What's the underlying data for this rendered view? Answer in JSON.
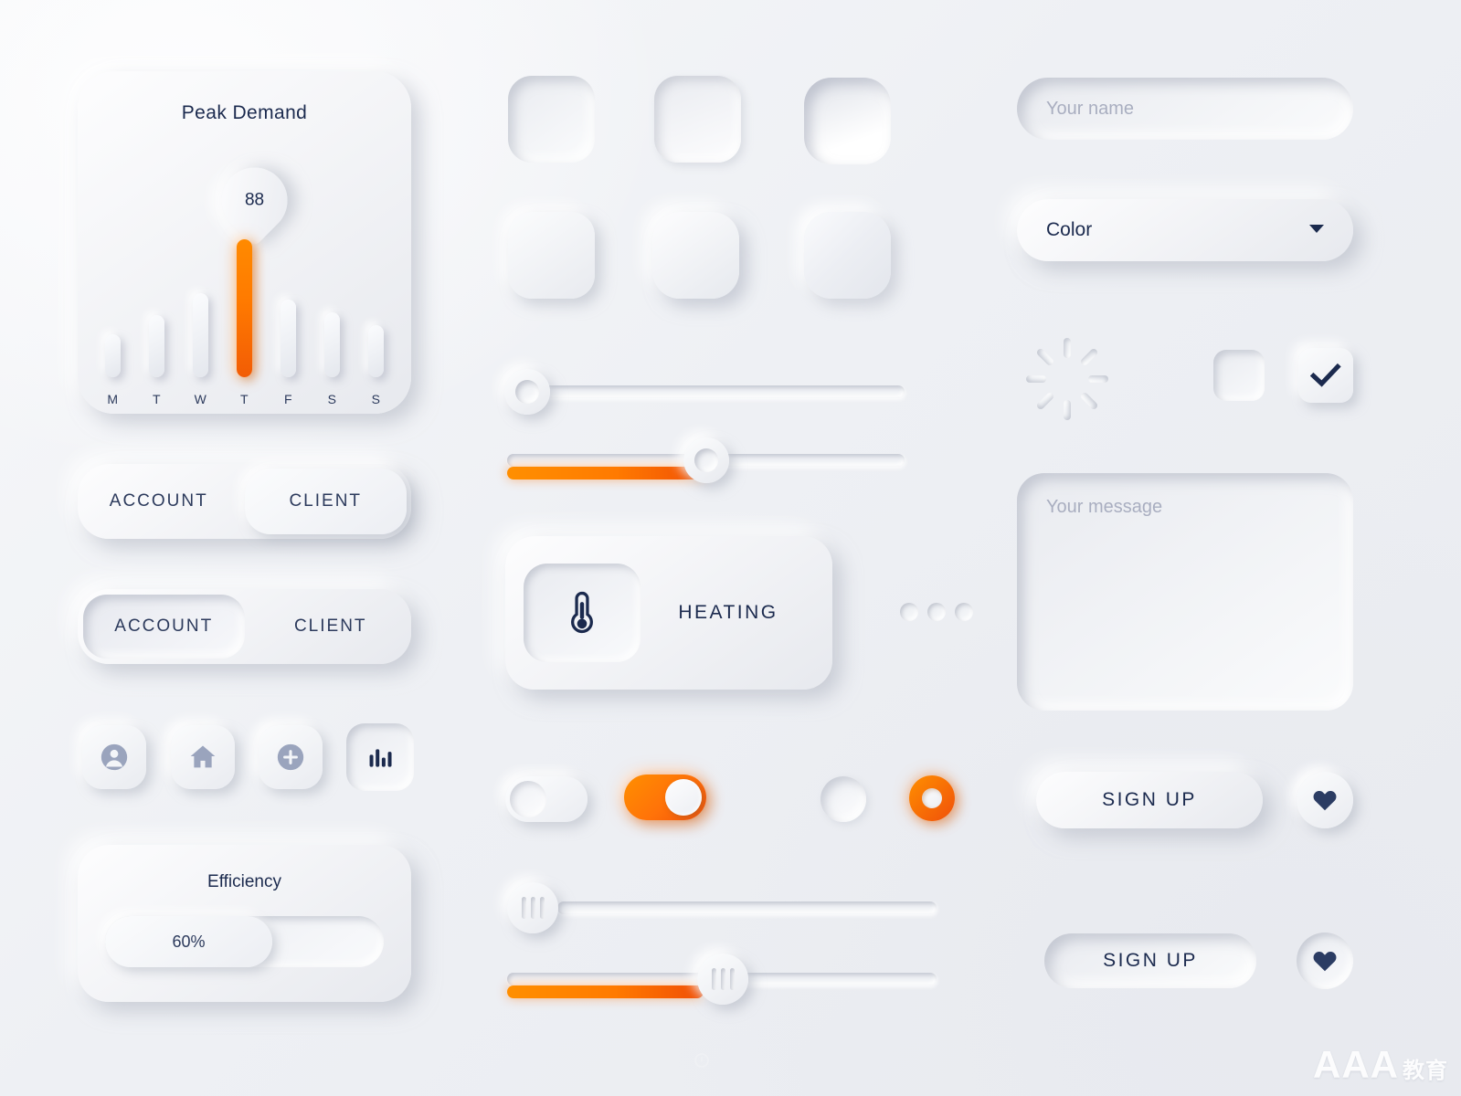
{
  "peak_card": {
    "title": "Peak Demand",
    "value": "88",
    "chart_data": {
      "type": "bar",
      "title": "Peak Demand",
      "categories": [
        "M",
        "T",
        "W",
        "T",
        "F",
        "S",
        "S"
      ],
      "values": [
        40,
        58,
        78,
        128,
        72,
        60,
        48
      ],
      "highlight_index": 3,
      "highlight_label": "88",
      "xlabel": "",
      "ylabel": "",
      "ylim": [
        0,
        140
      ],
      "grid": false,
      "legend": "none",
      "accent_color": "#ff7a00"
    }
  },
  "segmented_top": {
    "left_label": "ACCOUNT",
    "right_label": "CLIENT",
    "active": "CLIENT"
  },
  "segmented_bottom": {
    "left_label": "ACCOUNT",
    "right_label": "CLIENT",
    "active": "ACCOUNT"
  },
  "icon_buttons": [
    {
      "icon": "user-icon",
      "state": "raised"
    },
    {
      "icon": "home-icon",
      "state": "raised"
    },
    {
      "icon": "plus-circle-icon",
      "state": "raised"
    },
    {
      "icon": "bar-chart-icon",
      "state": "inset"
    }
  ],
  "efficiency": {
    "title": "Efficiency",
    "value_label": "60%",
    "percent": 60
  },
  "squares": [
    {
      "name": "square-inset-1",
      "style": "a"
    },
    {
      "name": "square-inset-2",
      "style": "b"
    },
    {
      "name": "square-inset-deep",
      "style": "c"
    },
    {
      "name": "square-raised-1",
      "style": "d"
    },
    {
      "name": "square-raised-2",
      "style": "e"
    },
    {
      "name": "square-raised-bevel",
      "style": "f"
    }
  ],
  "sliders": [
    {
      "name": "slider-circle-empty",
      "percent": 0,
      "handle": "circle",
      "filled": false
    },
    {
      "name": "slider-circle-filled",
      "percent": 45,
      "handle": "circle",
      "filled": true
    },
    {
      "name": "slider-ribbed-empty",
      "percent": 0,
      "handle": "ribbed",
      "filled": false
    },
    {
      "name": "slider-ribbed-filled",
      "percent": 45,
      "handle": "ribbed",
      "filled": true
    }
  ],
  "heating": {
    "label": "HEATING",
    "icon": "thermometer-icon"
  },
  "toggles": [
    {
      "name": "toggle-off",
      "state": "off"
    },
    {
      "name": "toggle-on",
      "state": "on"
    }
  ],
  "radios": [
    {
      "name": "radio-unselected",
      "state": "off"
    },
    {
      "name": "radio-selected",
      "state": "on"
    }
  ],
  "form": {
    "name_placeholder": "Your name",
    "select_label": "Color",
    "message_placeholder": "Your message"
  },
  "checkboxes": [
    {
      "name": "checkbox-unchecked",
      "checked": false
    },
    {
      "name": "checkbox-checked",
      "checked": true
    }
  ],
  "signup_buttons": [
    {
      "label": "SIGN UP",
      "state": "raised"
    },
    {
      "label": "SIGN UP",
      "state": "inset"
    }
  ],
  "heart_buttons": [
    {
      "icon": "heart-icon",
      "state": "raised"
    },
    {
      "icon": "heart-icon",
      "state": "inset"
    }
  ],
  "colors": {
    "accent_orange": "#ff7a00",
    "accent_orange_dark": "#f04e05",
    "navy_text": "#1b2a4e",
    "muted_text": "#a9aec0",
    "surface_light": "#fdfdfe",
    "surface_dark": "#e7e9ee"
  },
  "watermark": {
    "main": "AAA",
    "sub": "教育"
  }
}
